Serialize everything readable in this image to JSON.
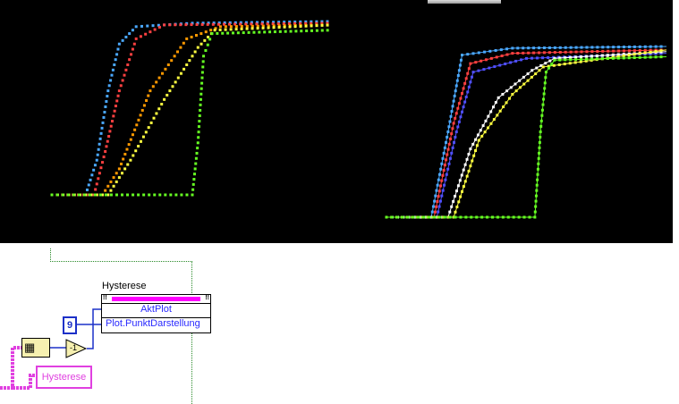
{
  "property_node": {
    "title": "Hysterese",
    "rows": [
      "AktPlot",
      "Plot.PunktDarstellung"
    ]
  },
  "constant": {
    "value": "9"
  },
  "negate": {
    "label": "-1"
  },
  "control": {
    "label": "Hysterese"
  },
  "colors": {
    "wire_blue": "#1c30c8",
    "wire_pink": "#e040e0",
    "graph_bg": "#000000"
  },
  "chart_data": [
    {
      "type": "scatter",
      "title": "",
      "series": [
        {
          "color": "#4aa8ff",
          "points": [
            [
              0,
              0
            ],
            [
              12,
              0
            ],
            [
              16,
              0.2
            ],
            [
              20,
              0.6
            ],
            [
              24,
              0.87
            ],
            [
              30,
              0.97
            ],
            [
              50,
              0.99
            ],
            [
              100,
              1
            ]
          ]
        },
        {
          "color": "#ff4040",
          "points": [
            [
              0,
              0
            ],
            [
              15,
              0
            ],
            [
              19,
              0.25
            ],
            [
              24,
              0.6
            ],
            [
              30,
              0.9
            ],
            [
              40,
              0.98
            ],
            [
              100,
              0.99
            ]
          ]
        },
        {
          "color": "#ff9900",
          "points": [
            [
              0,
              0
            ],
            [
              18,
              0
            ],
            [
              24,
              0.15
            ],
            [
              35,
              0.6
            ],
            [
              48,
              0.9
            ],
            [
              60,
              0.97
            ],
            [
              100,
              0.98
            ]
          ]
        },
        {
          "color": "#ffff40",
          "points": [
            [
              0,
              0
            ],
            [
              20,
              0
            ],
            [
              28,
              0.2
            ],
            [
              40,
              0.55
            ],
            [
              52,
              0.85
            ],
            [
              58,
              0.95
            ],
            [
              100,
              0.98
            ]
          ]
        },
        {
          "color": "#66ff22",
          "points": [
            [
              0,
              0
            ],
            [
              50,
              0
            ],
            [
              52,
              0.3
            ],
            [
              54,
              0.8
            ],
            [
              57,
              0.93
            ],
            [
              100,
              0.95
            ]
          ]
        }
      ]
    },
    {
      "type": "line",
      "title": "",
      "series": [
        {
          "color": "#4aa8ff",
          "points": [
            [
              0,
              0
            ],
            [
              16,
              0
            ],
            [
              22,
              0.5
            ],
            [
              27,
              0.95
            ],
            [
              45,
              0.99
            ],
            [
              100,
              1
            ]
          ]
        },
        {
          "color": "#ff4040",
          "points": [
            [
              0,
              0
            ],
            [
              17,
              0
            ],
            [
              24,
              0.55
            ],
            [
              30,
              0.9
            ],
            [
              45,
              0.96
            ],
            [
              100,
              0.98
            ]
          ]
        },
        {
          "color": "#5050ff",
          "points": [
            [
              0,
              0
            ],
            [
              18,
              0
            ],
            [
              25,
              0.5
            ],
            [
              31,
              0.85
            ],
            [
              50,
              0.93
            ],
            [
              100,
              0.96
            ]
          ]
        },
        {
          "color": "#ffffff",
          "points": [
            [
              0,
              0
            ],
            [
              22,
              0
            ],
            [
              30,
              0.4
            ],
            [
              40,
              0.7
            ],
            [
              52,
              0.86
            ],
            [
              60,
              0.93
            ],
            [
              100,
              0.97
            ]
          ]
        },
        {
          "color": "#ffff40",
          "points": [
            [
              0,
              0
            ],
            [
              24,
              0
            ],
            [
              33,
              0.45
            ],
            [
              45,
              0.72
            ],
            [
              56,
              0.88
            ],
            [
              100,
              0.98
            ]
          ]
        },
        {
          "color": "#66ff22",
          "points": [
            [
              0,
              0
            ],
            [
              53,
              0
            ],
            [
              55,
              0.5
            ],
            [
              57,
              0.85
            ],
            [
              60,
              0.92
            ],
            [
              100,
              0.94
            ]
          ]
        }
      ]
    }
  ]
}
